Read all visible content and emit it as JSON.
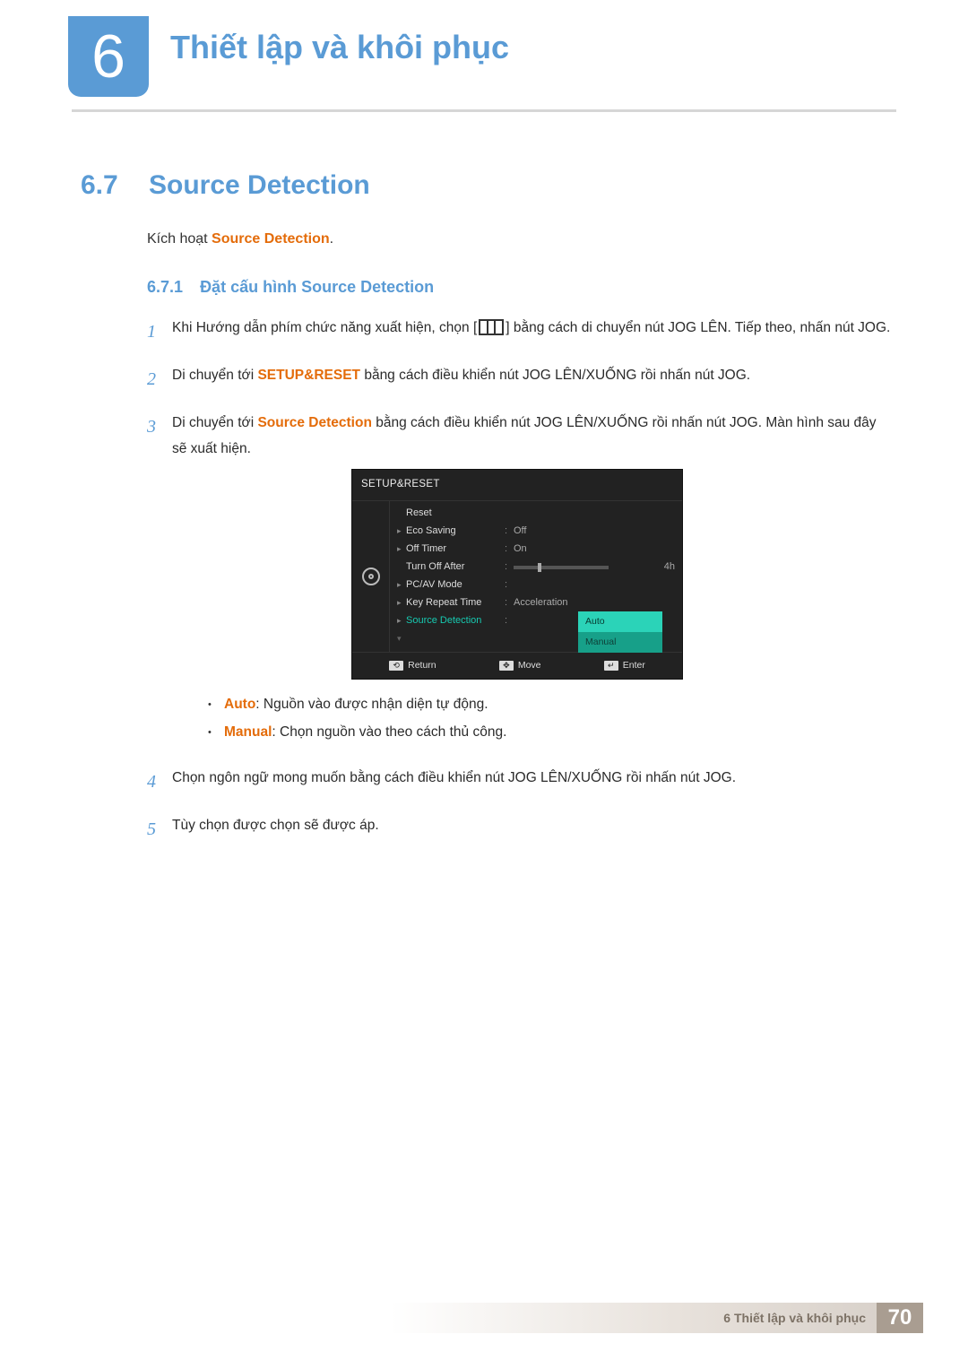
{
  "chapter": {
    "number": "6",
    "title": "Thiết lập và khôi phục"
  },
  "section": {
    "number": "6.7",
    "title": "Source Detection"
  },
  "intro": {
    "prefix": "Kích hoạt ",
    "highlight": "Source Detection",
    "suffix": "."
  },
  "subsection": {
    "number": "6.7.1",
    "title": "Đặt cấu hình Source Detection"
  },
  "steps": {
    "s1": {
      "n": "1",
      "t_a": "Khi Hướng dẫn phím chức năng xuất hiện, chọn [",
      "t_b": "] bằng cách di chuyển nút JOG LÊN. Tiếp theo, nhấn nút JOG."
    },
    "s2": {
      "n": "2",
      "t_a": "Di chuyển tới ",
      "hl": "SETUP&RESET",
      "t_b": " bằng cách điều khiển nút JOG LÊN/XUỐNG rồi nhấn nút JOG."
    },
    "s3": {
      "n": "3",
      "t_a": "Di chuyển tới ",
      "hl": "Source Detection",
      "t_b": " bằng cách điều khiển nút JOG LÊN/XUỐNG rồi nhấn nút JOG. Màn hình sau đây sẽ xuất hiện."
    },
    "s4": {
      "n": "4",
      "t": "Chọn ngôn ngữ mong muốn bằng cách điều khiển nút JOG LÊN/XUỐNG rồi nhấn nút JOG."
    },
    "s5": {
      "n": "5",
      "t": "Tùy chọn được chọn sẽ được áp."
    }
  },
  "osd": {
    "title": "SETUP&RESET",
    "rows": {
      "reset": {
        "label": "Reset",
        "value": ""
      },
      "eco": {
        "label": "Eco Saving",
        "value": "Off"
      },
      "off": {
        "label": "Off Timer",
        "value": "On"
      },
      "turn": {
        "label": "Turn Off After",
        "value": "4h"
      },
      "pcav": {
        "label": "PC/AV Mode",
        "value": ""
      },
      "key": {
        "label": "Key Repeat Time",
        "value": "Acceleration"
      },
      "src": {
        "label": "Source Detection",
        "value": ""
      }
    },
    "select": {
      "auto": "Auto",
      "manual": "Manual"
    },
    "footer": {
      "return": "Return",
      "move": "Move",
      "enter": "Enter"
    }
  },
  "bullets": {
    "auto": {
      "hl": "Auto",
      "t": ": Nguồn vào được nhận diện tự động."
    },
    "manual": {
      "hl": "Manual",
      "t": ": Chọn nguồn vào theo cách thủ công."
    }
  },
  "footer": {
    "text": "6 Thiết lập và khôi phục",
    "page": "70"
  }
}
